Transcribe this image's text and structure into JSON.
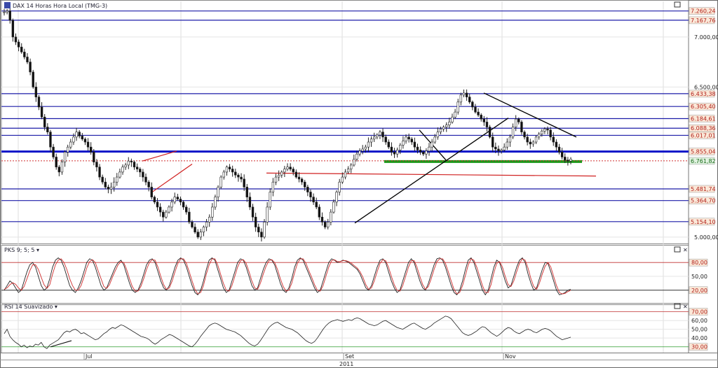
{
  "panels": {
    "price_title": "DAX 14 Horas Hora Local (TMG-3)",
    "pks_title": "PKS 9; 5; 5",
    "rsi_title": "RSI 14 Suavizado"
  },
  "colors": {
    "level_line": "#1c1ca8",
    "bold_level": "#0a14c8",
    "support": "#1a9a1a",
    "trend_black": "#000000",
    "trend_red": "#d02020",
    "label_box": "#fbe8d8",
    "label_text": "#b0201a",
    "pks_k": "#222222",
    "pks_d": "#d03030",
    "rsi_line": "#222222"
  },
  "chart_data": [
    {
      "type": "line",
      "id": "price",
      "title": "DAX 14 Horas Hora Local (TMG-3)",
      "ylim": [
        4950,
        7300
      ],
      "y_axis_ticks": [
        "7.000,00",
        "6.500,00",
        "5.000,00"
      ],
      "y_axis_tick_values": [
        7000,
        6500,
        5000
      ],
      "levels": [
        {
          "value": 7260.24,
          "label": "7.260,24"
        },
        {
          "value": 7167.76,
          "label": "7.167,76"
        },
        {
          "value": 6433.38,
          "label": "6.433,38"
        },
        {
          "value": 6305.4,
          "label": "6.305,40"
        },
        {
          "value": 6184.61,
          "label": "6.184,61"
        },
        {
          "value": 6088.36,
          "label": "6.088,36"
        },
        {
          "value": 6017.01,
          "label": "6.017,01"
        },
        {
          "value": 5855.04,
          "label": "5.855,04",
          "bold": true
        },
        {
          "value": 5481.74,
          "label": "5.481,74"
        },
        {
          "value": 5364.7,
          "label": "5.364,70"
        },
        {
          "value": 5154.1,
          "label": "5.154,10"
        }
      ],
      "current": {
        "value": 5761.82,
        "label": "6.761,82"
      },
      "support_zone": 5755,
      "x_ticks": [
        "Jul",
        "Set",
        "Nov"
      ],
      "year": "2011",
      "bars_count": 200,
      "series": [
        {
          "values": [
            7250,
            7260,
            7167,
            7000,
            6950,
            6900,
            6850,
            6800,
            6750,
            6650,
            6500,
            6400,
            6300,
            6200,
            6100,
            6050,
            5900,
            5800,
            5700,
            5650,
            5750,
            5850,
            5900,
            5950,
            6000,
            6050,
            6010,
            5980,
            5950,
            5900,
            5850,
            5750,
            5700,
            5600,
            5550,
            5500,
            5480,
            5500,
            5550,
            5600,
            5650,
            5700,
            5720,
            5760,
            5750,
            5700,
            5680,
            5650,
            5600,
            5550,
            5500,
            5400,
            5350,
            5300,
            5250,
            5200,
            5250,
            5300,
            5350,
            5400,
            5380,
            5350,
            5300,
            5250,
            5150,
            5100,
            5050,
            5000,
            5050,
            5100,
            5150,
            5200,
            5300,
            5400,
            5500,
            5600,
            5650,
            5700,
            5680,
            5650,
            5620,
            5600,
            5580,
            5500,
            5400,
            5300,
            5200,
            5100,
            5050,
            5000,
            5150,
            5300,
            5450,
            5550,
            5600,
            5620,
            5650,
            5680,
            5700,
            5680,
            5650,
            5600,
            5580,
            5550,
            5500,
            5450,
            5400,
            5350,
            5300,
            5200,
            5150,
            5100,
            5150,
            5250,
            5350,
            5450,
            5550,
            5600,
            5650,
            5680,
            5720,
            5780,
            5830,
            5860,
            5880,
            5900,
            5950,
            5980,
            6000,
            6020,
            6050,
            6000,
            5950,
            5900,
            5850,
            5830,
            5870,
            5920,
            5960,
            6000,
            5980,
            5950,
            5900,
            5870,
            5850,
            5830,
            5860,
            5900,
            5950,
            6000,
            6050,
            6080,
            6100,
            6120,
            6150,
            6200,
            6250,
            6350,
            6420,
            6440,
            6400,
            6350,
            6300,
            6250,
            6220,
            6180,
            6150,
            6100,
            6000,
            5900,
            5880,
            5860,
            5870,
            5900,
            5950,
            6000,
            6100,
            6180,
            6150,
            6050,
            6000,
            5950,
            5930,
            5950,
            6000,
            6030,
            6060,
            6080,
            6070,
            6000,
            5950,
            5900,
            5850,
            5800,
            5770,
            5760,
            5780
          ]
        }
      ]
    },
    {
      "type": "line",
      "id": "pks",
      "title": "PKS 9; 5; 5",
      "ylim": [
        0,
        100
      ],
      "y_axis_ticks": [
        "80,00",
        "50,00",
        "20,00"
      ],
      "y_axis_tick_values": [
        80,
        50,
        20
      ],
      "series": [
        {
          "name": "K",
          "values": [
            20,
            30,
            40,
            35,
            25,
            15,
            20,
            40,
            60,
            75,
            80,
            70,
            50,
            30,
            20,
            25,
            45,
            70,
            85,
            90,
            85,
            70,
            50,
            30,
            20,
            15,
            25,
            40,
            60,
            80,
            88,
            85,
            70,
            50,
            30,
            20,
            25,
            40,
            55,
            70,
            80,
            85,
            75,
            55,
            35,
            20,
            15,
            20,
            35,
            55,
            75,
            85,
            88,
            80,
            60,
            40,
            25,
            20,
            30,
            50,
            70,
            85,
            90,
            85,
            70,
            50,
            30,
            15,
            10,
            20,
            40,
            65,
            85,
            90,
            85,
            65,
            45,
            25,
            15,
            20,
            40,
            60,
            80,
            88,
            85,
            70,
            50,
            30,
            20,
            25,
            45,
            65,
            80,
            88,
            85,
            75,
            55,
            35,
            20,
            15,
            25,
            45,
            70,
            85,
            90,
            85,
            70,
            55,
            40,
            25,
            15,
            20,
            40,
            60,
            80,
            88,
            85,
            80,
            82,
            85,
            83,
            80,
            75,
            70,
            65,
            55,
            40,
            25,
            20,
            30,
            50,
            70,
            85,
            88,
            80,
            60,
            40,
            25,
            15,
            20,
            40,
            60,
            80,
            88,
            80,
            60,
            40,
            25,
            20,
            35,
            55,
            75,
            88,
            90,
            85,
            70,
            50,
            30,
            15,
            10,
            20,
            40,
            65,
            85,
            90,
            80,
            60,
            40,
            20,
            10,
            20,
            45,
            70,
            85,
            80,
            60,
            40,
            25,
            30,
            50,
            70,
            85,
            90,
            80,
            55,
            35,
            20,
            25,
            45,
            65,
            80,
            78,
            60,
            40,
            20,
            10,
            12,
            15,
            20,
            22
          ]
        },
        {
          "name": "D",
          "values": [
            22,
            25,
            32,
            36,
            33,
            25,
            20,
            28,
            45,
            62,
            75,
            75,
            65,
            48,
            32,
            24,
            32,
            55,
            75,
            85,
            88,
            80,
            65,
            45,
            30,
            20,
            20,
            30,
            48,
            68,
            82,
            86,
            80,
            62,
            45,
            28,
            24,
            32,
            48,
            62,
            75,
            82,
            80,
            65,
            45,
            28,
            18,
            18,
            28,
            45,
            65,
            80,
            86,
            85,
            70,
            50,
            32,
            22,
            25,
            40,
            60,
            78,
            88,
            88,
            78,
            60,
            40,
            22,
            12,
            15,
            30,
            55,
            75,
            88,
            88,
            75,
            55,
            35,
            20,
            18,
            30,
            50,
            70,
            84,
            86,
            78,
            60,
            40,
            25,
            22,
            35,
            55,
            72,
            84,
            86,
            80,
            65,
            45,
            28,
            18,
            20,
            35,
            58,
            78,
            88,
            88,
            78,
            62,
            48,
            32,
            20,
            18,
            30,
            50,
            70,
            84,
            86,
            82,
            82,
            84,
            84,
            82,
            78,
            73,
            68,
            60,
            48,
            32,
            22,
            25,
            40,
            60,
            78,
            86,
            84,
            70,
            50,
            32,
            20,
            18,
            30,
            50,
            70,
            84,
            84,
            70,
            50,
            32,
            22,
            28,
            45,
            65,
            82,
            88,
            88,
            78,
            60,
            40,
            22,
            12,
            15,
            30,
            52,
            75,
            88,
            85,
            70,
            50,
            30,
            15,
            15,
            32,
            58,
            78,
            82,
            70,
            50,
            32,
            28,
            40,
            60,
            78,
            88,
            85,
            68,
            45,
            28,
            22,
            35,
            55,
            72,
            80,
            70,
            50,
            30,
            15,
            12,
            13,
            17,
            20
          ]
        }
      ]
    },
    {
      "type": "line",
      "id": "rsi",
      "title": "RSI 14 Suavizado",
      "ylim": [
        25,
        72
      ],
      "y_axis_ticks": [
        "70,00",
        "60,00",
        "50,00",
        "40,00",
        "30,00"
      ],
      "y_axis_tick_values": [
        70,
        60,
        50,
        40,
        30
      ],
      "series": [
        {
          "values": [
            45,
            50,
            42,
            38,
            35,
            33,
            30,
            32,
            29,
            31,
            30,
            33,
            32,
            35,
            30,
            28,
            32,
            34,
            36,
            38,
            42,
            46,
            48,
            47,
            49,
            50,
            48,
            45,
            46,
            44,
            42,
            40,
            38,
            39,
            42,
            45,
            47,
            50,
            52,
            51,
            53,
            55,
            54,
            52,
            50,
            48,
            46,
            44,
            42,
            41,
            40,
            38,
            35,
            33,
            35,
            38,
            40,
            42,
            44,
            43,
            41,
            39,
            37,
            35,
            33,
            31,
            30,
            33,
            37,
            42,
            46,
            50,
            54,
            56,
            57,
            56,
            54,
            52,
            50,
            49,
            48,
            47,
            45,
            43,
            40,
            37,
            34,
            32,
            31,
            33,
            37,
            42,
            47,
            52,
            55,
            57,
            58,
            56,
            54,
            52,
            51,
            50,
            48,
            46,
            43,
            40,
            37,
            35,
            34,
            36,
            40,
            45,
            50,
            54,
            57,
            59,
            60,
            61,
            60,
            59,
            60,
            61,
            60,
            62,
            63,
            62,
            60,
            58,
            56,
            55,
            54,
            55,
            57,
            59,
            60,
            58,
            56,
            54,
            52,
            51,
            50,
            52,
            54,
            56,
            57,
            55,
            53,
            51,
            50,
            52,
            54,
            57,
            59,
            61,
            63,
            65,
            64,
            62,
            58,
            54,
            50,
            46,
            44,
            43,
            44,
            46,
            48,
            51,
            53,
            52,
            49,
            46,
            44,
            42,
            44,
            47,
            50,
            52,
            51,
            48,
            46,
            45,
            47,
            49,
            50,
            49,
            47,
            46,
            48,
            50,
            51,
            50,
            48,
            45,
            42,
            40,
            38,
            39,
            40,
            41
          ]
        }
      ]
    }
  ]
}
